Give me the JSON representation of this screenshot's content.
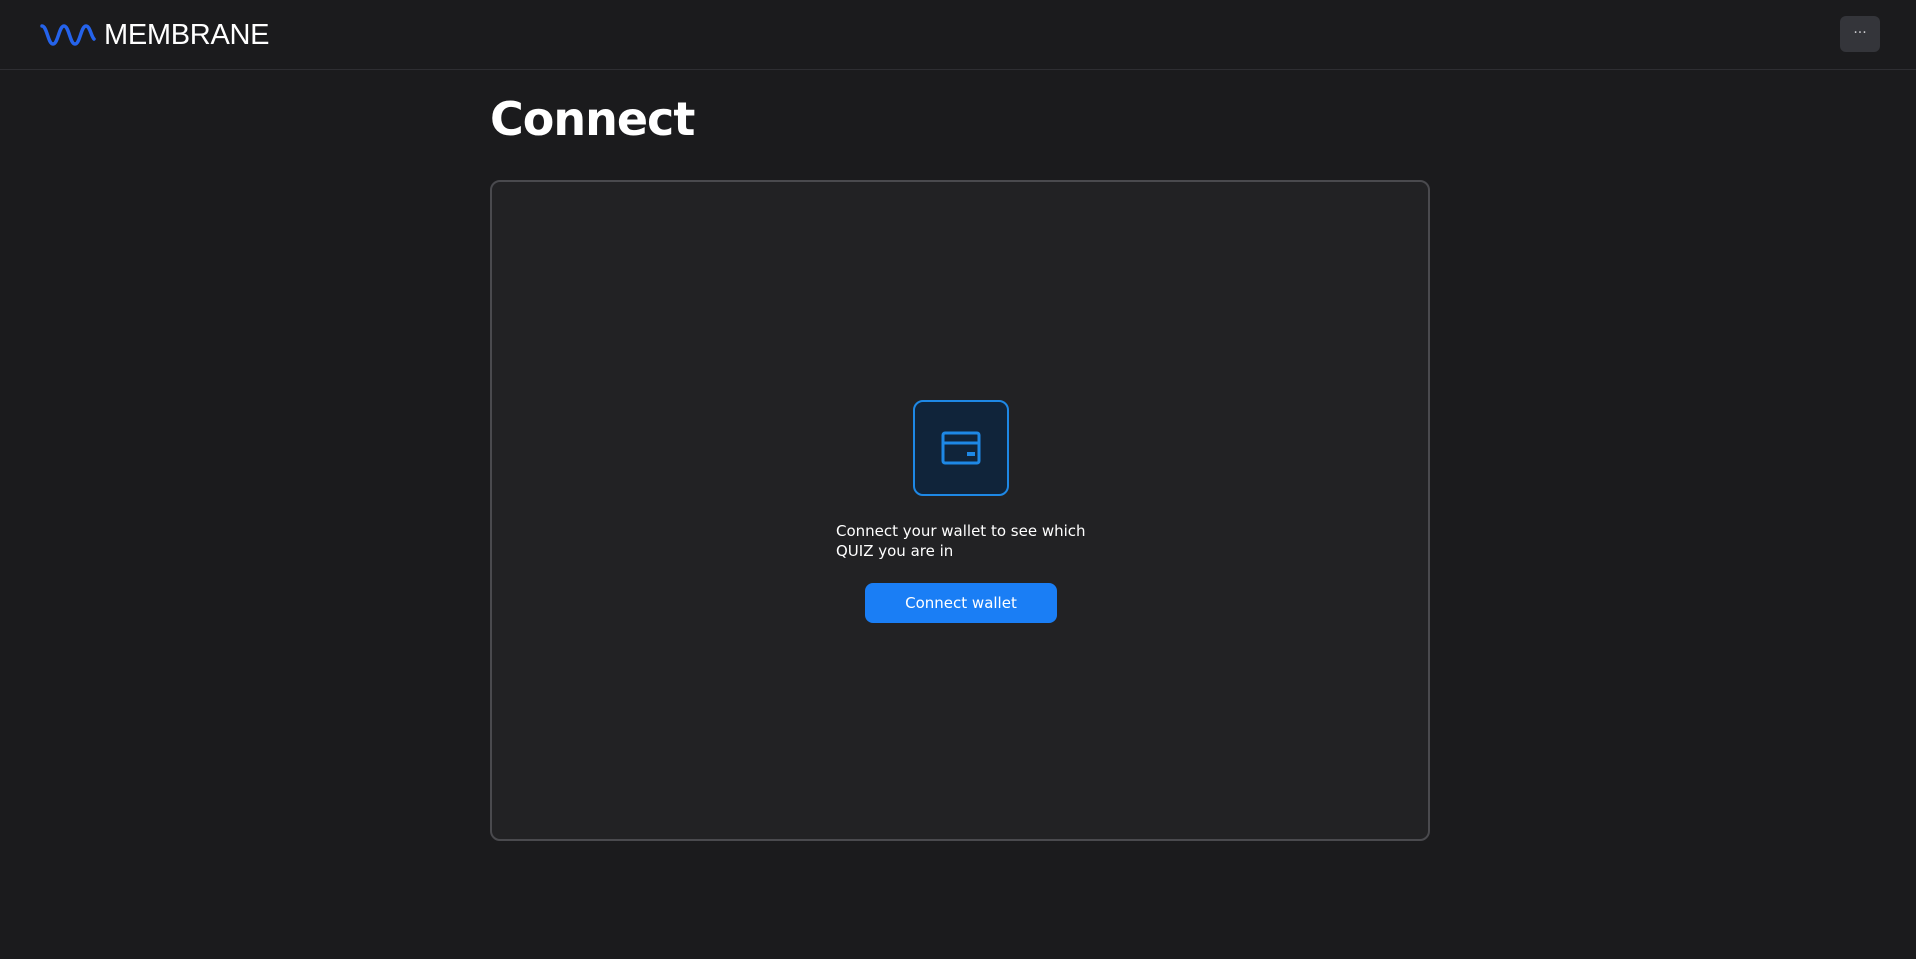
{
  "header": {
    "logo_text": "MEMBRANE",
    "logo_icon": "wave-logo-icon",
    "menu_label": "···",
    "brand_color": "#2563eb"
  },
  "main": {
    "title": "Connect",
    "card": {
      "icon": "wallet-icon",
      "message": "Connect your wallet to see which QUIZ you are in",
      "button_label": "Connect wallet",
      "accent_color": "#1a7ef5"
    }
  }
}
